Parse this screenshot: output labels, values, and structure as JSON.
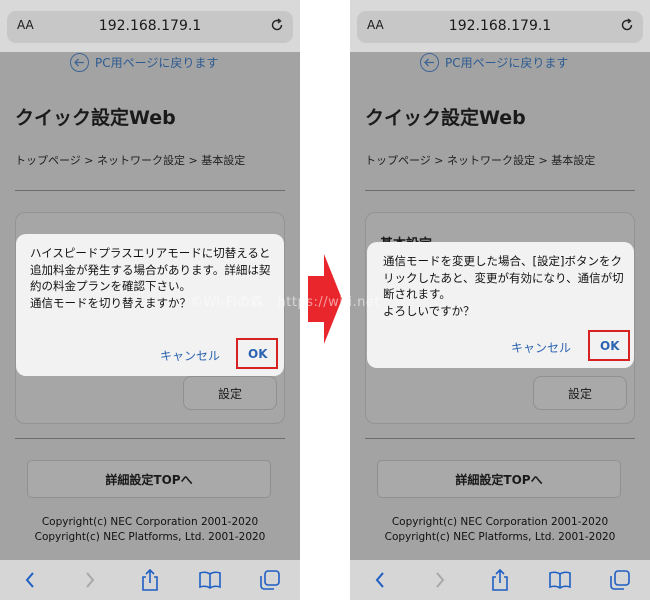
{
  "browser": {
    "aa_label": "AA",
    "url": "192.168.179.1"
  },
  "page": {
    "pc_link": "PC用ページに戻ります",
    "title": "クイック設定Web",
    "breadcrumb": "トップページ > ネットワーク設定 > 基本設定",
    "card_title": "基本設定",
    "set_button": "設定",
    "detail_button": "詳細設定TOPへ",
    "copyright_1": "Copyright(c) NEC Corporation 2001-2020",
    "copyright_2": "Copyright(c) NEC Platforms, Ltd. 2001-2020"
  },
  "dialog_left": {
    "message": "ハイスピードプラスエリアモードに切替えると追加料金が発生する場合があります。詳細は契約の料金プランを確認下さい。\n通信モードを切り替えますか？",
    "cancel": "キャンセル",
    "ok": "OK"
  },
  "dialog_right": {
    "message": "通信モードを変更した場合、[設定]ボタンをクリックしたあと、変更が有効になり、通信が切断されます。\nよろしいですか？",
    "cancel": "キャンセル",
    "ok": "OK"
  },
  "watermark": "©Wi-Fiの森　https://wifi.net",
  "colors": {
    "highlight": "#d62222",
    "link": "#2c64b0",
    "arrow": "#e8262b"
  },
  "icons": [
    "back-arrow-icon",
    "reload-icon",
    "chevron-left-icon",
    "chevron-right-icon",
    "share-icon",
    "book-icon",
    "tabs-icon",
    "right-arrow-icon"
  ]
}
